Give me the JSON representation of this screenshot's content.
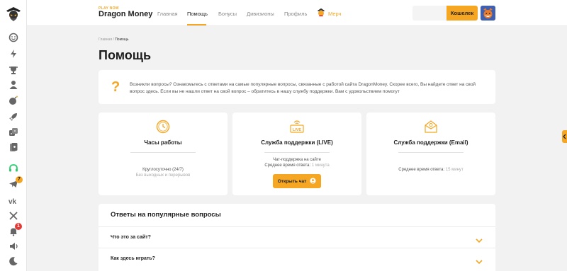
{
  "brand": {
    "tagline": "PLAY NOW",
    "name": "Dragon Money"
  },
  "nav": [
    {
      "label": "Главная",
      "active": false
    },
    {
      "label": "Помощь",
      "active": true
    },
    {
      "label": "Бонусы",
      "active": false
    },
    {
      "label": "Дивизионы",
      "active": false
    },
    {
      "label": "Профиль",
      "active": false
    }
  ],
  "merch_label": "Мерч",
  "wallet_label": "Кошелек",
  "breadcrumb": {
    "home": "Главная",
    "sep": "/",
    "current": "Помощь"
  },
  "page_title": "Помощь",
  "info": {
    "icon": "question-mark-icon",
    "text": "Возникли вопросы? Ознакомьтесь с ответами на самые популярные вопросы, связанные с работой сайта DragonMoney. Скорее всего, Вы найдете ответ на свой вопрос здесь. Если вы не нашли ответ на свой вопрос – обратитесь в нашу службу поддержки. Вам с удовольствием помогут"
  },
  "cards": {
    "hours": {
      "title": "Часы работы",
      "line1": "Круглосуточно (24/7)",
      "line2": "Без выходных и перерывов"
    },
    "live": {
      "title": "Служба поддержки (LIVE)",
      "line1": "Чат-поддержка на сайте",
      "line2_label": "Среднее время ответа:",
      "line2_value": "1 минута",
      "button": "Открыть чат"
    },
    "email": {
      "title": "Служба поддержки (Email)",
      "line1_label": "Среднее время ответа:",
      "line1_value": "15 минут"
    }
  },
  "faq": {
    "title": "Ответы на популярные вопросы",
    "items": [
      {
        "question": "Что это за сайт?"
      },
      {
        "question": "Как здесь играть?"
      }
    ]
  },
  "sidebar_badges": {
    "telegram": "7",
    "notifications": "1"
  },
  "colors": {
    "accent": "#f5a623",
    "background": "#f2f2f2",
    "card": "#ffffff",
    "badge_red": "#e53935",
    "badge_orange": "#f5a623",
    "support_green": "#2ecc71"
  }
}
